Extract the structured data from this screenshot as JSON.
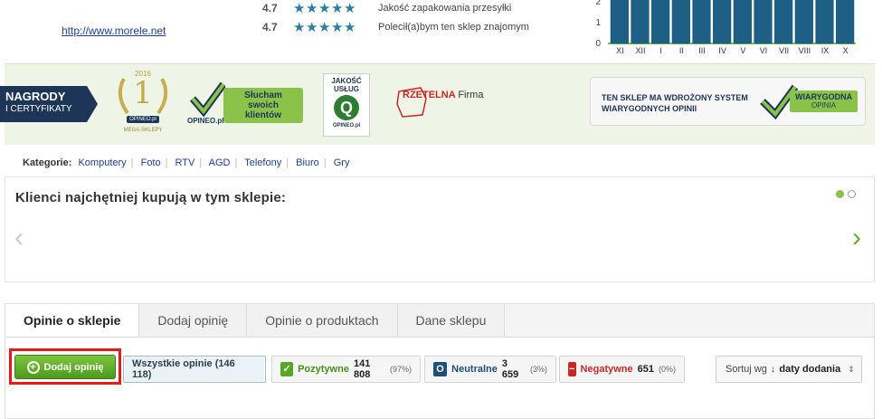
{
  "store": {
    "url": "http://www.morele.net",
    "ratings": [
      {
        "score": "4.7",
        "label": "Jakość zapakowania przesyłki"
      },
      {
        "score": "4.7",
        "label": "Polecił(a)bym ten sklep znajomym"
      }
    ]
  },
  "chart_data": {
    "type": "bar",
    "categories": [
      "XI",
      "XII",
      "I",
      "II",
      "III",
      "IV",
      "V",
      "VI",
      "VII",
      "VIII",
      "IX",
      "X"
    ],
    "yticks": [
      "0",
      "1",
      "2"
    ],
    "values": [
      3,
      3,
      3,
      3,
      3,
      3,
      3,
      3,
      3,
      3,
      3,
      3
    ],
    "colors": {
      "bar": "#1e5f85",
      "border": "#7ec045"
    }
  },
  "awards": {
    "tag_title": "NAGRODY",
    "tag_sub": "I CERTYFIKATY",
    "wreath_year": "2016",
    "wreath_number": "1",
    "wreath_brand": "OPINEO.pl",
    "wreath_caption": "MEGA-SKLEPY",
    "listen_text": "Słucham swoich klientów",
    "listen_brand": "OPINEO.pl",
    "quality_text": "JAKOŚĆ USŁUG",
    "quality_letter": "Q",
    "quality_brand": "OPINEO.pl",
    "rzetelna_red": "RZETELNA",
    "rzetelna_black": "Firma",
    "verified_text": "TEN SKLEP MA WDROŻONY SYSTEM WIARYGODNYCH OPINII",
    "verified_pill": "WIARYGODNA",
    "verified_pill_sub": "OPINIA"
  },
  "categories": {
    "label": "Kategorie:",
    "items": [
      "Komputery",
      "Foto",
      "RTV",
      "AGD",
      "Telefony",
      "Biuro",
      "Gry"
    ]
  },
  "carousel": {
    "heading": "Klienci najchętniej kupują w tym sklepie:",
    "prev": "‹",
    "next": "›"
  },
  "tabs": [
    {
      "label": "Opinie o sklepie",
      "active": true
    },
    {
      "label": "Dodaj opinię",
      "active": false
    },
    {
      "label": "Opinie o produktach",
      "active": false
    },
    {
      "label": "Dane sklepu",
      "active": false
    }
  ],
  "actions": {
    "add_review": "Dodaj opinię",
    "all": "Wszystkie opinie (146 118)",
    "positive_name": "Pozytywne",
    "positive_count": "141 808",
    "positive_pct": "(97%)",
    "neutral_name": "Neutralne",
    "neutral_count": "3 659",
    "neutral_pct": "(3%)",
    "negative_name": "Negatywne",
    "negative_count": "651",
    "negative_pct": "(0%)",
    "sort_label": "Sortuj wg",
    "sort_value": "daty dodania"
  },
  "icons": {
    "star": "star-icon",
    "check": "check-icon",
    "neutral": "circle-icon",
    "negative": "minus-icon",
    "add": "plus-circle-icon",
    "sort": "arrow-down-icon"
  }
}
